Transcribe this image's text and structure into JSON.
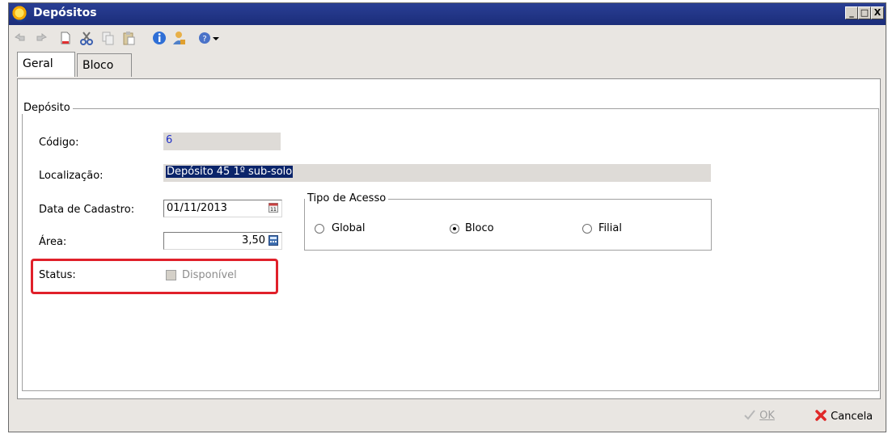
{
  "window": {
    "title": "Depósitos",
    "buttons": {
      "minimize": "_",
      "maximize": "□",
      "close": "X"
    }
  },
  "toolbar": {
    "icons": [
      "undo-icon",
      "redo-icon",
      "new-document-icon",
      "cut-icon",
      "copy-icon",
      "paste-icon",
      "info-icon",
      "user-icon",
      "help-icon",
      "dropdown-arrow-icon"
    ]
  },
  "tabs": [
    {
      "label": "Geral",
      "active": true
    },
    {
      "label": "Bloco",
      "active": false
    }
  ],
  "group": {
    "legend": "Depósito"
  },
  "form": {
    "codigo_label": "Código:",
    "codigo_value": "6",
    "localizacao_label": "Localização:",
    "localizacao_value": "Depósito 45 1º sub-solo",
    "data_label": "Data de Cadastro:",
    "data_value": "01/11/2013",
    "area_label": "Área:",
    "area_value": "3,50",
    "status_label": "Status:",
    "status_checkbox_label": "Disponível",
    "status_checked": false
  },
  "acesso": {
    "legend": "Tipo de Acesso",
    "options": [
      {
        "label": "Global",
        "checked": false
      },
      {
        "label": "Bloco",
        "checked": true
      },
      {
        "label": "Filial",
        "checked": false
      }
    ]
  },
  "footer": {
    "ok_label": "OK",
    "cancel_label": "Cancela"
  },
  "colors": {
    "title_bar": "#1b2d7a",
    "highlight": "#e0202a",
    "selection": "#0a246a"
  }
}
